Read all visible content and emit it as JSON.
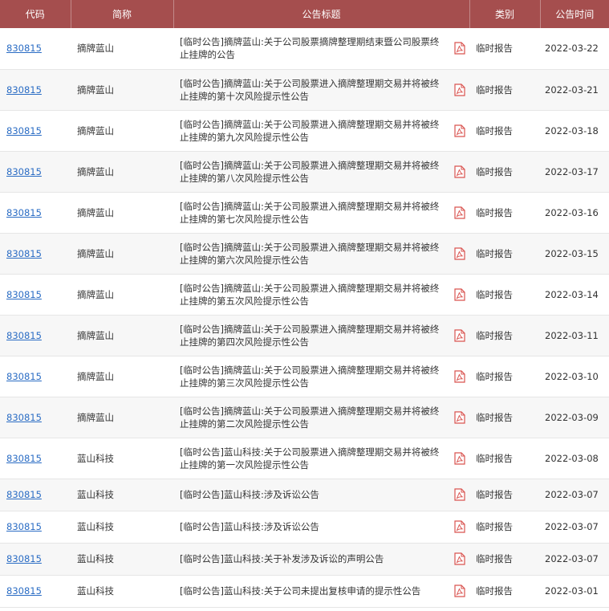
{
  "header": {
    "code": "代码",
    "name": "简称",
    "title": "公告标题",
    "type": "类别",
    "date": "公告时间"
  },
  "rows": [
    {
      "code": "830815",
      "name": "摘牌蓝山",
      "title": "[临时公告]摘牌蓝山:关于公司股票摘牌整理期结束暨公司股票终止挂牌的公告",
      "type": "临时报告",
      "date": "2022-03-22",
      "icon": "pdf-icon"
    },
    {
      "code": "830815",
      "name": "摘牌蓝山",
      "title": "[临时公告]摘牌蓝山:关于公司股票进入摘牌整理期交易并将被终止挂牌的第十次风险提示性公告",
      "type": "临时报告",
      "date": "2022-03-21",
      "icon": "pdf-icon"
    },
    {
      "code": "830815",
      "name": "摘牌蓝山",
      "title": "[临时公告]摘牌蓝山:关于公司股票进入摘牌整理期交易并将被终止挂牌的第九次风险提示性公告",
      "type": "临时报告",
      "date": "2022-03-18",
      "icon": "pdf-icon"
    },
    {
      "code": "830815",
      "name": "摘牌蓝山",
      "title": "[临时公告]摘牌蓝山:关于公司股票进入摘牌整理期交易并将被终止挂牌的第八次风险提示性公告",
      "type": "临时报告",
      "date": "2022-03-17",
      "icon": "pdf-icon"
    },
    {
      "code": "830815",
      "name": "摘牌蓝山",
      "title": "[临时公告]摘牌蓝山:关于公司股票进入摘牌整理期交易并将被终止挂牌的第七次风险提示性公告",
      "type": "临时报告",
      "date": "2022-03-16",
      "icon": "pdf-icon"
    },
    {
      "code": "830815",
      "name": "摘牌蓝山",
      "title": "[临时公告]摘牌蓝山:关于公司股票进入摘牌整理期交易并将被终止挂牌的第六次风险提示性公告",
      "type": "临时报告",
      "date": "2022-03-15",
      "icon": "pdf-icon"
    },
    {
      "code": "830815",
      "name": "摘牌蓝山",
      "title": "[临时公告]摘牌蓝山:关于公司股票进入摘牌整理期交易并将被终止挂牌的第五次风险提示性公告",
      "type": "临时报告",
      "date": "2022-03-14",
      "icon": "pdf-icon"
    },
    {
      "code": "830815",
      "name": "摘牌蓝山",
      "title": "[临时公告]摘牌蓝山:关于公司股票进入摘牌整理期交易并将被终止挂牌的第四次风险提示性公告",
      "type": "临时报告",
      "date": "2022-03-11",
      "icon": "pdf-icon"
    },
    {
      "code": "830815",
      "name": "摘牌蓝山",
      "title": "[临时公告]摘牌蓝山:关于公司股票进入摘牌整理期交易并将被终止挂牌的第三次风险提示性公告",
      "type": "临时报告",
      "date": "2022-03-10",
      "icon": "pdf-icon"
    },
    {
      "code": "830815",
      "name": "摘牌蓝山",
      "title": "[临时公告]摘牌蓝山:关于公司股票进入摘牌整理期交易并将被终止挂牌的第二次风险提示性公告",
      "type": "临时报告",
      "date": "2022-03-09",
      "icon": "pdf-icon"
    },
    {
      "code": "830815",
      "name": "蓝山科技",
      "title": "[临时公告]蓝山科技:关于公司股票进入摘牌整理期交易并将被终止挂牌的第一次风险提示性公告",
      "type": "临时报告",
      "date": "2022-03-08",
      "icon": "pdf-icon"
    },
    {
      "code": "830815",
      "name": "蓝山科技",
      "title": "[临时公告]蓝山科技:涉及诉讼公告",
      "type": "临时报告",
      "date": "2022-03-07",
      "icon": "pdf-icon"
    },
    {
      "code": "830815",
      "name": "蓝山科技",
      "title": "[临时公告]蓝山科技:涉及诉讼公告",
      "type": "临时报告",
      "date": "2022-03-07",
      "icon": "pdf-icon"
    },
    {
      "code": "830815",
      "name": "蓝山科技",
      "title": "[临时公告]蓝山科技:关于补发涉及诉讼的声明公告",
      "type": "临时报告",
      "date": "2022-03-07",
      "icon": "pdf-icon"
    },
    {
      "code": "830815",
      "name": "蓝山科技",
      "title": "[临时公告]蓝山科技:关于公司未提出复核申请的提示性公告",
      "type": "临时报告",
      "date": "2022-03-01",
      "icon": "pdf-icon"
    }
  ],
  "colors": {
    "header_bg": "#a54e4e",
    "link": "#2a6cc4",
    "pdf_icon": "#d9534f"
  }
}
